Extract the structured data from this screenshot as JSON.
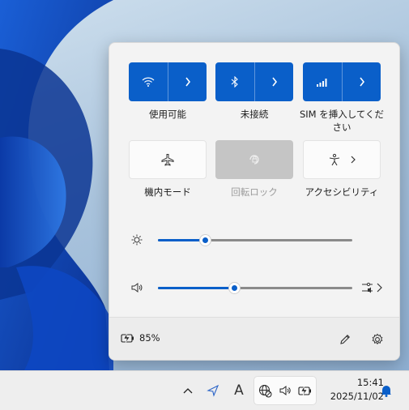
{
  "quick_settings": {
    "tiles": [
      {
        "label": "使用可能",
        "icon": "wifi-icon",
        "state": "on",
        "has_more": true
      },
      {
        "label": "未接続",
        "icon": "bluetooth-icon",
        "state": "on",
        "has_more": true
      },
      {
        "label": "SIM を挿入してください",
        "icon": "cellular-icon",
        "state": "on",
        "has_more": true
      },
      {
        "label": "機内モード",
        "icon": "airplane-icon",
        "state": "off"
      },
      {
        "label": "回転ロック",
        "icon": "rotation-lock-icon",
        "state": "disabled"
      },
      {
        "label": "アクセシビリティ",
        "icon": "accessibility-icon",
        "state": "off",
        "has_more": true
      }
    ],
    "brightness": {
      "icon": "brightness-icon",
      "value_fraction": 0.24
    },
    "volume": {
      "icon": "speaker-icon",
      "value_fraction": 0.39
    },
    "footer": {
      "battery_text": "85%",
      "battery_icon": "battery-charging-icon"
    }
  },
  "taskbar": {
    "time": "15:41",
    "date": "2025/11/02",
    "ime_label": "A"
  },
  "colors": {
    "accent": "#0a5fc9",
    "panel": "#f3f3f3",
    "taskbar": "#eeeeee"
  }
}
